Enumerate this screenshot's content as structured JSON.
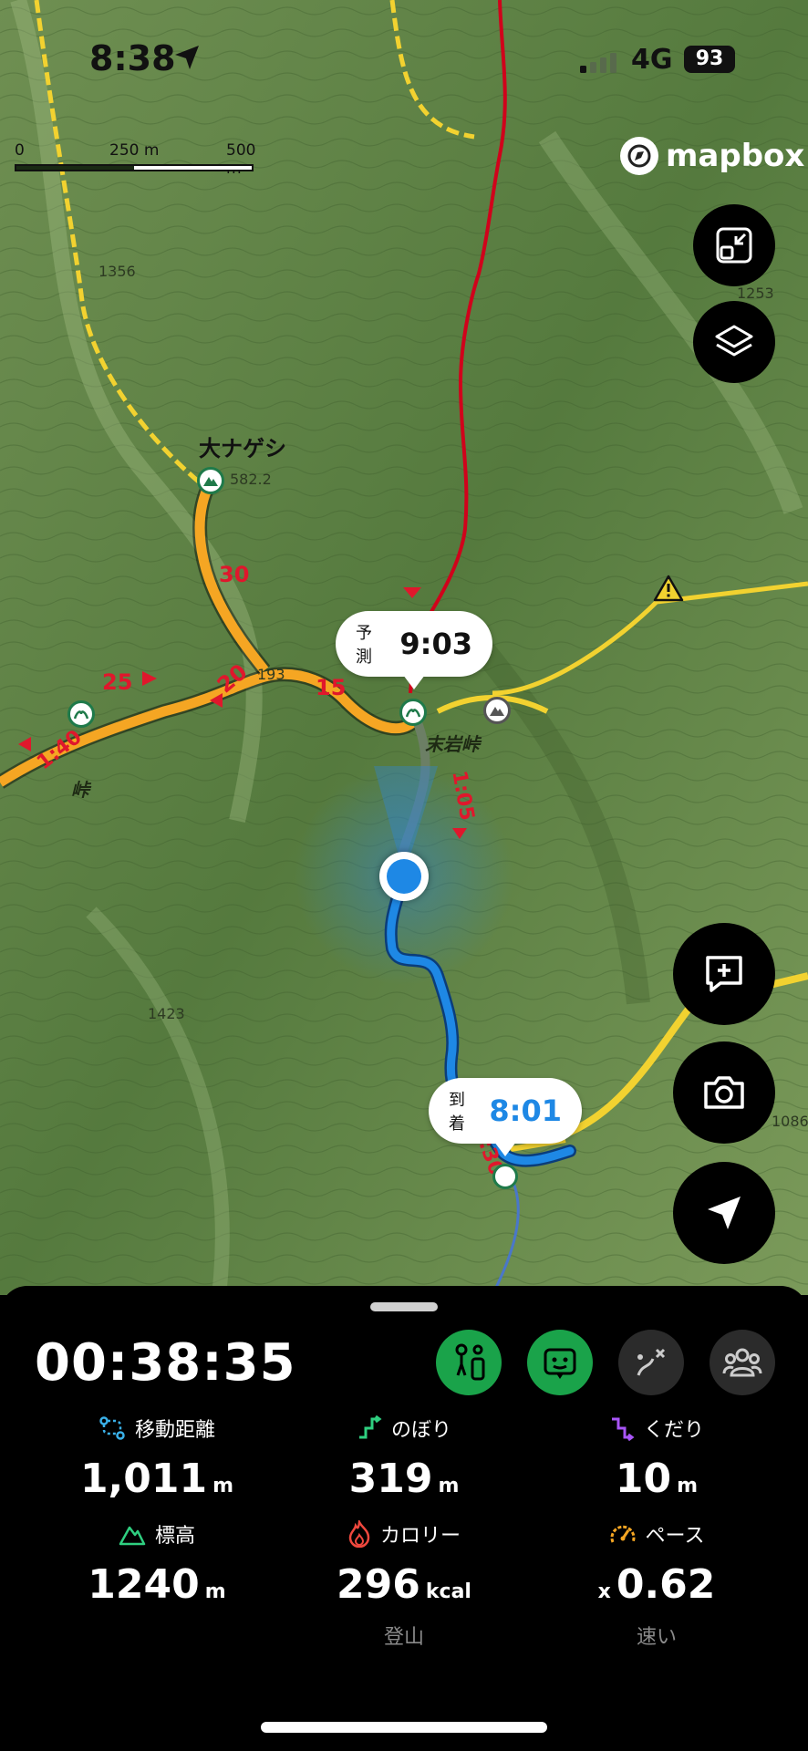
{
  "status_bar": {
    "time": "8:38",
    "network": "4G",
    "battery": "93"
  },
  "map": {
    "scale": {
      "zero": "0",
      "mid": "250 m",
      "end": "500 m"
    },
    "attribution": "mapbox",
    "peak_name": "大ナゲシ",
    "peak_elev": "582.2",
    "pass_label_1": "末岩峠",
    "pass_label_2": "峠",
    "elev_labels": [
      "1356",
      "1253",
      "1423",
      "1086",
      "193"
    ],
    "segment_labels": [
      "30",
      "25",
      "20",
      "15",
      "1:40",
      "1:05",
      "1:30"
    ],
    "callouts": {
      "forecast": {
        "label": "予測",
        "value": "9:03"
      },
      "arrival": {
        "label": "到着",
        "value": "8:01"
      }
    },
    "buttons": [
      "shrink",
      "layers",
      "add-note",
      "camera",
      "locate"
    ]
  },
  "sheet": {
    "elapsed": "00:38:35",
    "stats": {
      "distance": {
        "label": "移動距離",
        "value": "1,011",
        "unit": "m"
      },
      "ascent": {
        "label": "のぼり",
        "value": "319",
        "unit": "m"
      },
      "descent": {
        "label": "くだり",
        "value": "10",
        "unit": "m"
      },
      "elevation": {
        "label": "標高",
        "value": "1240",
        "unit": "m"
      },
      "calories": {
        "label": "カロリー",
        "value": "296",
        "unit": "kcal",
        "sub": "登山"
      },
      "pace": {
        "label": "ペース",
        "prefix": "x",
        "value": "0.62",
        "sub": "速い"
      }
    }
  },
  "colors": {
    "track": "#1e88e5",
    "route": "#f5a623",
    "path_red": "#d0021b",
    "path_yellow": "#f2d230",
    "active_mode": "#1aa34a",
    "segment_red": "#e0172c"
  }
}
